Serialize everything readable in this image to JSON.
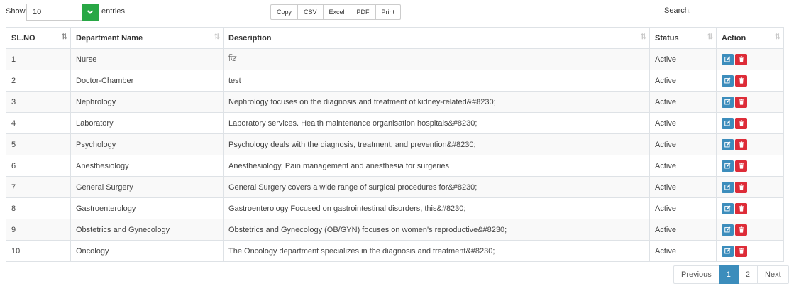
{
  "controls": {
    "show_label": "Show",
    "length_value": "10",
    "entries_label": "entries",
    "search_label": "Search:",
    "search_value": "",
    "export_buttons": [
      "Copy",
      "CSV",
      "Excel",
      "PDF",
      "Print"
    ]
  },
  "table": {
    "columns": [
      "SL.NO",
      "Department Name",
      "Description",
      "Status",
      "Action"
    ],
    "rows": [
      {
        "sl": "1",
        "name": "Nurse",
        "desc": "ডি",
        "status": "Active"
      },
      {
        "sl": "2",
        "name": "Doctor-Chamber",
        "desc": "test",
        "status": "Active"
      },
      {
        "sl": "3",
        "name": "Nephrology",
        "desc": "Nephrology focuses on the diagnosis and treatment of kidney-related&#8230;",
        "status": "Active"
      },
      {
        "sl": "4",
        "name": "Laboratory",
        "desc": "Laboratory services. Health maintenance organisation hospitals&#8230;",
        "status": "Active"
      },
      {
        "sl": "5",
        "name": "Psychology",
        "desc": "Psychology deals with the diagnosis, treatment, and prevention&#8230;",
        "status": "Active"
      },
      {
        "sl": "6",
        "name": "Anesthesiology",
        "desc": "Anesthesiology, Pain management and anesthesia for surgeries",
        "status": "Active"
      },
      {
        "sl": "7",
        "name": "General Surgery",
        "desc": "General Surgery covers a wide range of surgical procedures for&#8230;",
        "status": "Active"
      },
      {
        "sl": "8",
        "name": "Gastroenterology",
        "desc": "Gastroenterology Focused on gastrointestinal disorders, this&#8230;",
        "status": "Active"
      },
      {
        "sl": "9",
        "name": "Obstetrics and Gynecology",
        "desc": "Obstetrics and Gynecology (OB/GYN) focuses on women's reproductive&#8230;",
        "status": "Active"
      },
      {
        "sl": "10",
        "name": "Oncology",
        "desc": "The Oncology department specializes in the diagnosis and treatment&#8230;",
        "status": "Active"
      }
    ]
  },
  "pagination": {
    "previous": "Previous",
    "pages": [
      "1",
      "2"
    ],
    "active_page": "1",
    "next": "Next"
  },
  "colors": {
    "select_arrow": "#28a745",
    "edit_button": "#3c8dbc",
    "delete_button": "#dd2c38",
    "active_page": "#3c8dbc"
  },
  "icons": {
    "length_arrow": "chevron-down-icon",
    "edit": "edit-icon",
    "delete": "trash-icon",
    "sort": "sort-icon"
  }
}
